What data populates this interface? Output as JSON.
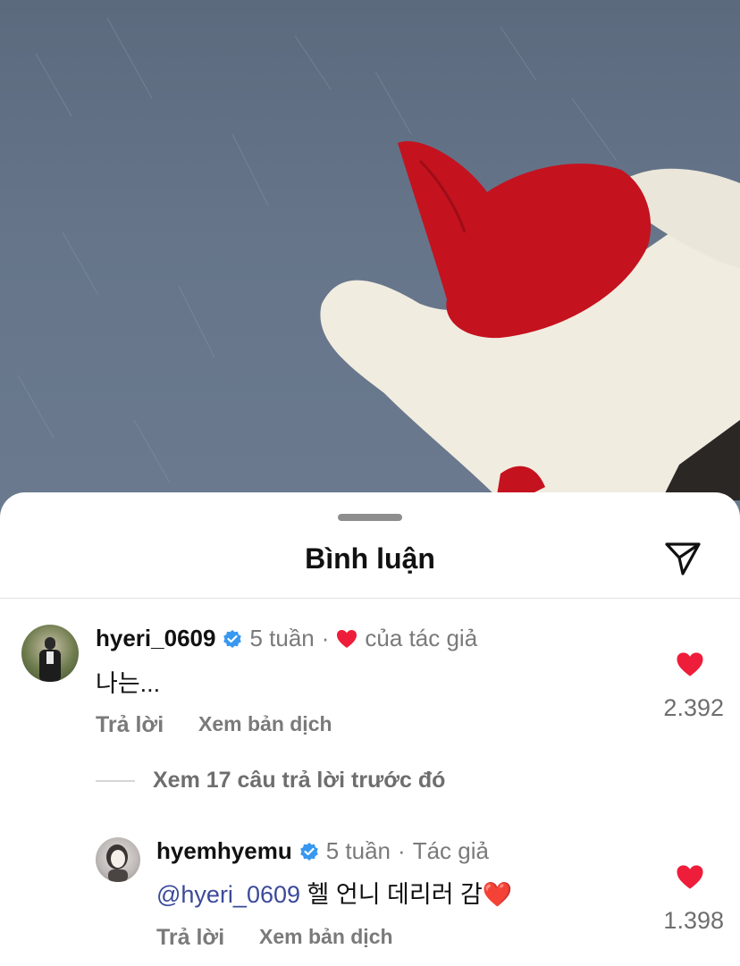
{
  "sheet": {
    "title": "Bình luận",
    "share_icon": "paper-plane-icon"
  },
  "comments": [
    {
      "username": "hyeri_0609",
      "verified": true,
      "time": "5 tuần",
      "separator": "·",
      "author_liked_label": "của tác giả",
      "text": "나는...",
      "reply_label": "Trả lời",
      "translate_label": "Xem bản dịch",
      "likes": "2.392"
    },
    {
      "username": "hyemhyemu",
      "verified": true,
      "time": "5 tuần",
      "separator": "·",
      "author_badge": "Tác giả",
      "mention": "@hyeri_0609",
      "text": " 헬 언니 데리러 감",
      "emoji": "❤️",
      "reply_label": "Trả lời",
      "translate_label": "Xem bản dịch",
      "likes": "1.398"
    }
  ],
  "view_previous_replies": "Xem 17 câu trả lời trước đó",
  "colors": {
    "heart": "#ee1d3a",
    "verified": "#3897f0",
    "mention": "#3b4a9a"
  }
}
